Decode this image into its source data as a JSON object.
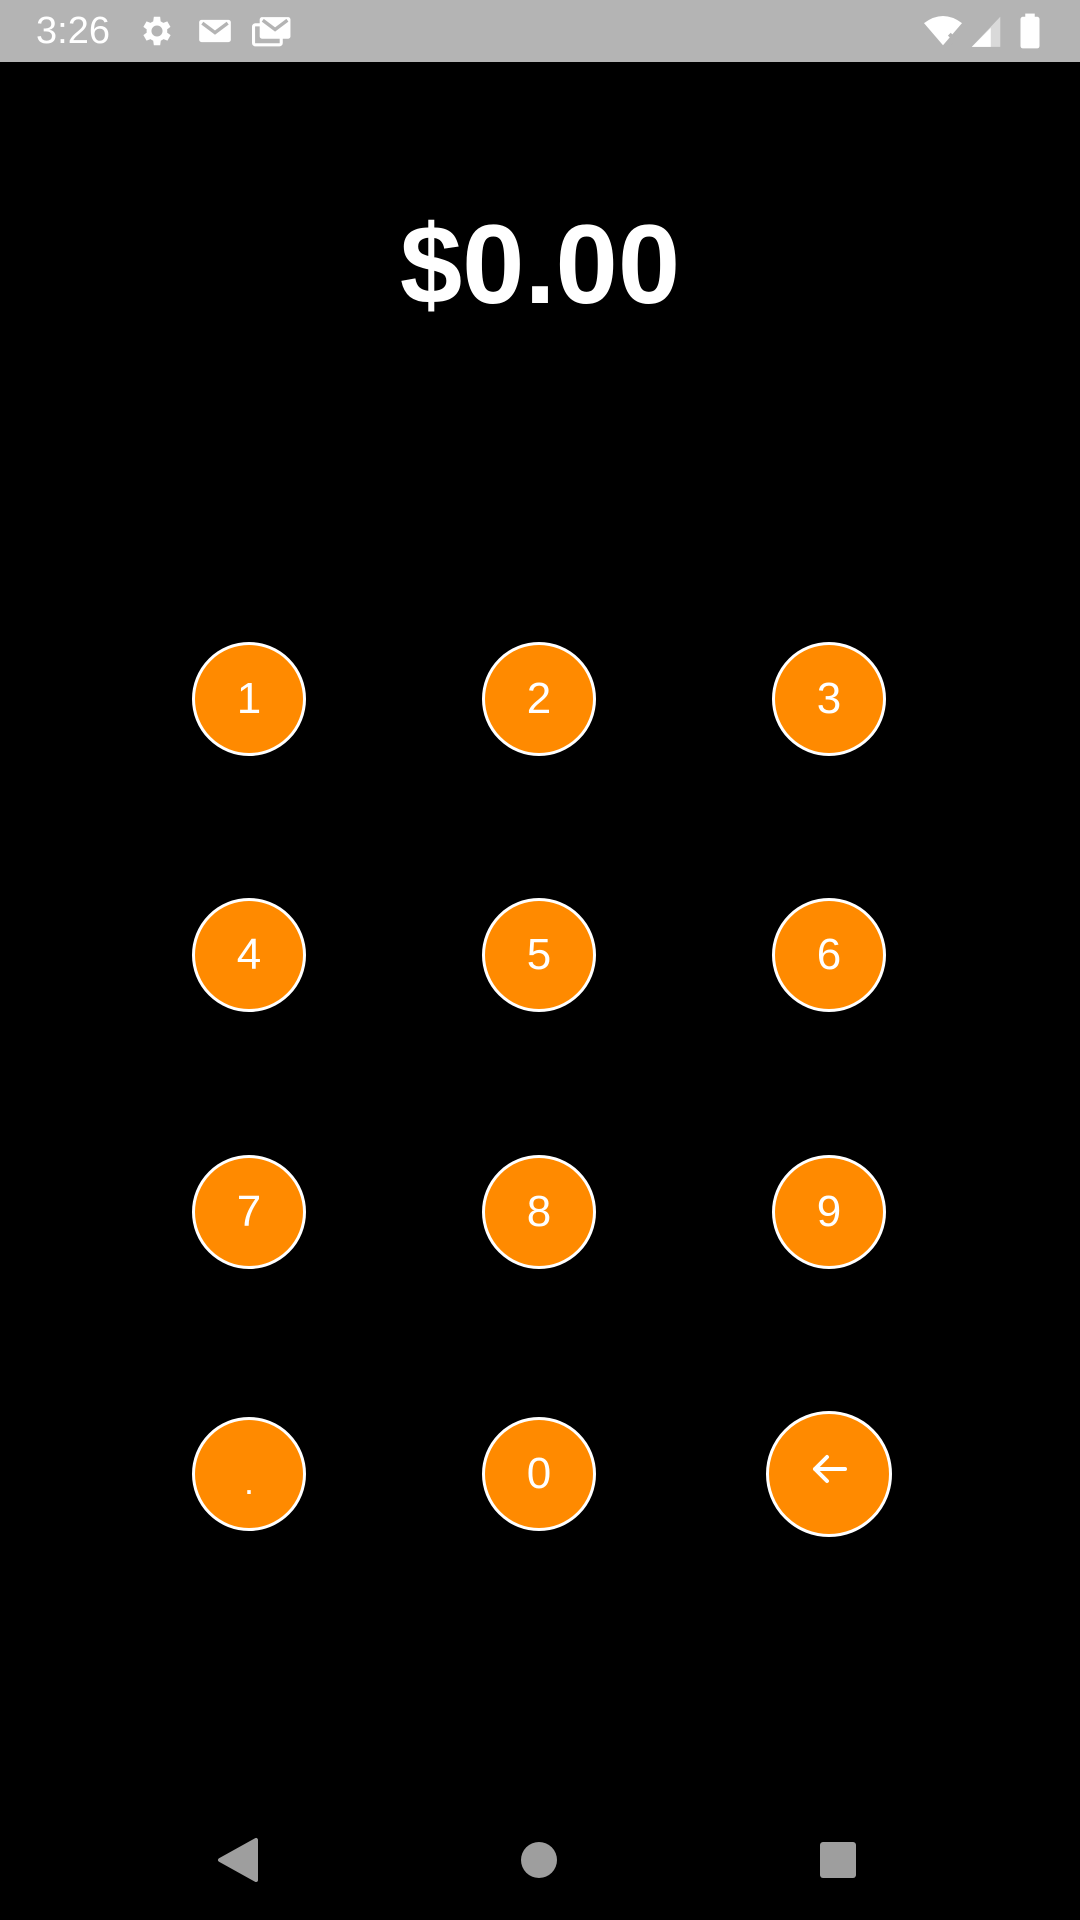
{
  "status_bar": {
    "time": "3:26",
    "icons": [
      "gear-icon",
      "gmail-icon",
      "gmail-stack-icon",
      "wifi-off-icon",
      "signal-icon",
      "battery-icon"
    ]
  },
  "display": {
    "amount": "$0.00"
  },
  "keypad": {
    "keys": [
      {
        "label": "1"
      },
      {
        "label": "2"
      },
      {
        "label": "3"
      },
      {
        "label": "4"
      },
      {
        "label": "5"
      },
      {
        "label": "6"
      },
      {
        "label": "7"
      },
      {
        "label": "8"
      },
      {
        "label": "9"
      },
      {
        "label": "."
      },
      {
        "label": "0"
      },
      {
        "icon": "backspace-arrow-icon"
      }
    ],
    "key_color": "#ff8a00",
    "key_border_color": "#ffffff"
  },
  "nav_bar": {
    "buttons": [
      "back-icon",
      "home-icon",
      "recents-icon"
    ]
  }
}
